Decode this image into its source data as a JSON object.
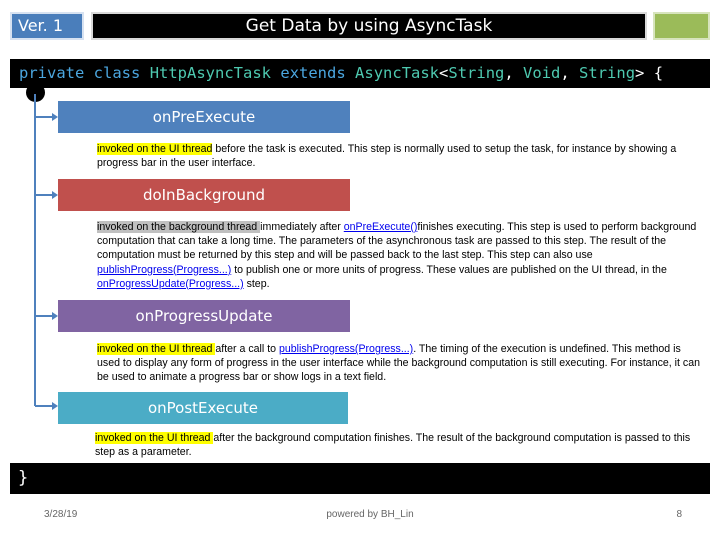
{
  "header": {
    "version_label": "Ver. 1",
    "title": "Get Data by using AsyncTask"
  },
  "code": {
    "kw_private": "private",
    "kw_class": "class",
    "class_name": "HttpAsyncTask",
    "kw_extends": "extends",
    "superclass": "AsyncTask",
    "lt": "<",
    "type1": "String",
    "type2": "Void",
    "type3": "String",
    "gt_brace": "> {",
    "closing_brace": "}"
  },
  "steps": [
    {
      "title": "onPreExecute",
      "highlight": "invoked on the UI thread",
      "text": " before the task is executed. This step is normally used to setup the task, for instance by showing a progress bar in the user interface."
    },
    {
      "title": "doInBackground",
      "highlight": "invoked on the background thread ",
      "text_a": "immediately after ",
      "link_a": "onPreExecute()",
      "text_b": "finishes executing. This step is used to perform background computation that can take a long time. The parameters of the asynchronous task are passed to this step. The result of the computation must be returned by this step and will be passed back to the last step. This step can also use ",
      "link_b": "publishProgress(Progress...)",
      "text_c": " to publish one or more units of progress. These values are published on the UI thread, in the ",
      "link_c": "onProgressUpdate(Progress...)",
      "text_d": " step."
    },
    {
      "title": "onProgressUpdate",
      "highlight": "invoked on the UI thread ",
      "text_a": "after a call to ",
      "link_a": "publishProgress(Progress...)",
      "text_b": ". The timing of the execution is undefined. This method is used to display any form of progress in the user interface while the background computation is still executing. For instance, it can be used to animate a progress bar or show logs in a text field."
    },
    {
      "title": "onPostExecute",
      "highlight": "invoked on the UI thread ",
      "text": "after the background computation finishes. The result of the background computation is passed to this step as a parameter."
    }
  ],
  "footer": {
    "date": "3/28/19",
    "credit": "powered by BH_Lin",
    "page": "8"
  }
}
